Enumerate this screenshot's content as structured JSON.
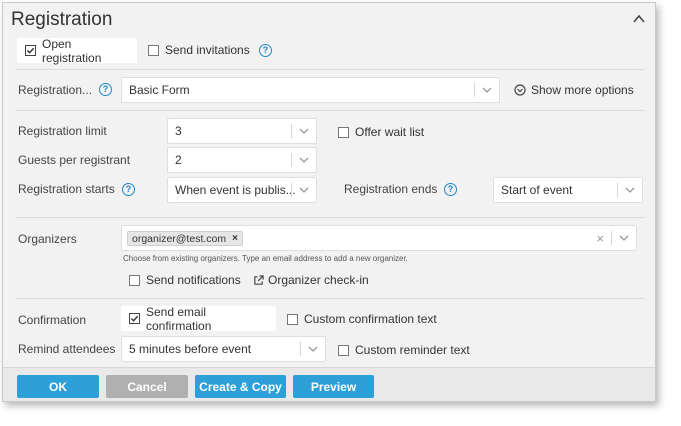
{
  "dialog": {
    "title": "Registration"
  },
  "top_options": {
    "open_registration": "Open registration",
    "send_invitations": "Send invitations"
  },
  "registration_form": {
    "label": "Registration...",
    "value": "Basic Form",
    "show_more": "Show more options"
  },
  "limit": {
    "label": "Registration limit",
    "value": "3",
    "offer_wait_list": "Offer wait list"
  },
  "guests": {
    "label": "Guests per registrant",
    "value": "2"
  },
  "starts": {
    "label": "Registration starts",
    "value": "When event is publis..."
  },
  "ends": {
    "label": "Registration ends",
    "value": "Start of event"
  },
  "organizers": {
    "label": "Organizers",
    "chip": "organizer@test.com",
    "hint": "Choose from existing organizers. Type an email address to add a new organizer.",
    "send_notifications": "Send notifications",
    "check_in": "Organizer check-in"
  },
  "confirmation": {
    "label": "Confirmation",
    "send_email": "Send email confirmation",
    "custom_text": "Custom confirmation text"
  },
  "remind": {
    "label": "Remind attendees",
    "value": "5 minutes before event",
    "custom_text": "Custom reminder text"
  },
  "footer": {
    "ok": "OK",
    "cancel": "Cancel",
    "create_copy": "Create & Copy",
    "preview": "Preview"
  },
  "help_glyph": "?",
  "colors": {
    "accent": "#2d9fd9",
    "background": "#f2f2f2",
    "help": "#1e88c8"
  }
}
